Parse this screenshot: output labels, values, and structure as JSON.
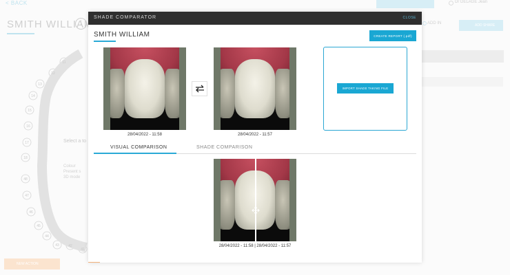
{
  "background": {
    "back_label": "< BACK",
    "patient_title": "SMITH WILLIAM",
    "info_icon": "info-icon",
    "top_button_label": "",
    "user_name": "Dr DELAGE Jean",
    "add_in_label": "ADD IN",
    "share_button_label": "ADD SHARE",
    "select_hint": "Select a to",
    "legend_title": "Colour",
    "legend_items": [
      "Present s",
      "3D mode"
    ],
    "left_button_label": "NEW ACTION",
    "tooth_numbers": [
      "11",
      "12",
      "13",
      "14",
      "15",
      "16",
      "17",
      "18",
      "48",
      "47",
      "46",
      "45",
      "44",
      "43",
      "42",
      "41"
    ]
  },
  "modal": {
    "title": "SHADE COMPARATOR",
    "close_label": "CLOSE",
    "patient_name": "SMITH WILLIAM",
    "create_report_label": "CREATE REPORT (.pdf)",
    "photos": [
      {
        "date": "28/04/2022 - 11:58"
      },
      {
        "date": "28/04/2022 - 11:57"
      }
    ],
    "swap_icon": "swap-arrows-icon",
    "import_label": "IMPORT SHADE TAKING FILE",
    "tabs": [
      {
        "label": "VISUAL COMPARISON",
        "active": true
      },
      {
        "label": "SHADE COMPARISON",
        "active": false
      }
    ],
    "comparison_date": "28/04/2022 - 11:58 | 28/04/2022 - 11:57",
    "drag_handle_icon": "drag-handle-icon"
  },
  "colors": {
    "accent": "#1aa7d3",
    "header": "#2f2f2f"
  }
}
